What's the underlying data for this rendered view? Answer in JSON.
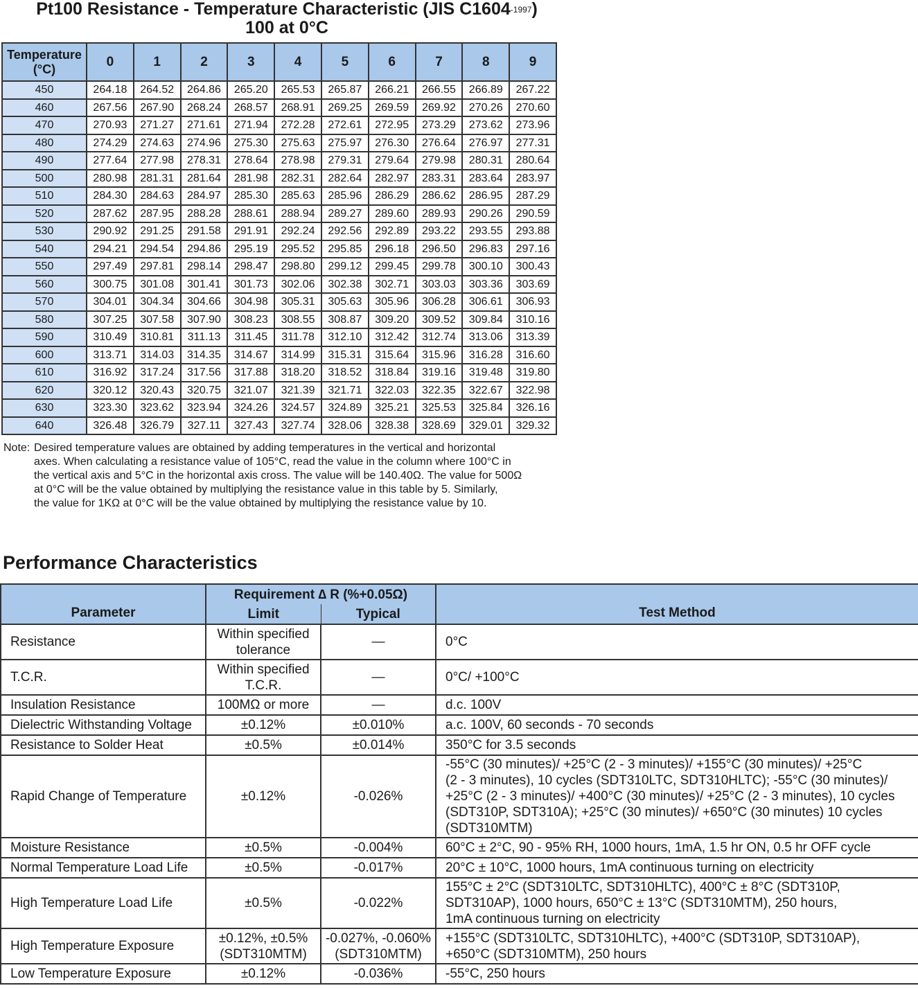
{
  "title": {
    "line1_main": "Pt100 Resistance - Temperature Characteristic (JIS C1604",
    "line1_sup": "-1997",
    "line1_close": ")",
    "line2": "100 at 0°C"
  },
  "resistance_table": {
    "header_temp_line1": "Temperature",
    "header_temp_line2": "(°C)",
    "columns": [
      "0",
      "1",
      "2",
      "3",
      "4",
      "5",
      "6",
      "7",
      "8",
      "9"
    ],
    "rows": [
      {
        "temp": "450",
        "values": [
          "264.18",
          "264.52",
          "264.86",
          "265.20",
          "265.53",
          "265.87",
          "266.21",
          "266.55",
          "266.89",
          "267.22"
        ]
      },
      {
        "temp": "460",
        "values": [
          "267.56",
          "267.90",
          "268.24",
          "268.57",
          "268.91",
          "269.25",
          "269.59",
          "269.92",
          "270.26",
          "270.60"
        ]
      },
      {
        "temp": "470",
        "values": [
          "270.93",
          "271.27",
          "271.61",
          "271.94",
          "272.28",
          "272.61",
          "272.95",
          "273.29",
          "273.62",
          "273.96"
        ]
      },
      {
        "temp": "480",
        "values": [
          "274.29",
          "274.63",
          "274.96",
          "275.30",
          "275.63",
          "275.97",
          "276.30",
          "276.64",
          "276.97",
          "277.31"
        ]
      },
      {
        "temp": "490",
        "values": [
          "277.64",
          "277.98",
          "278.31",
          "278.64",
          "278.98",
          "279.31",
          "279.64",
          "279.98",
          "280.31",
          "280.64"
        ]
      },
      {
        "temp": "500",
        "values": [
          "280.98",
          "281.31",
          "281.64",
          "281.98",
          "282.31",
          "282.64",
          "282.97",
          "283.31",
          "283.64",
          "283.97"
        ]
      },
      {
        "temp": "510",
        "values": [
          "284.30",
          "284.63",
          "284.97",
          "285.30",
          "285.63",
          "285.96",
          "286.29",
          "286.62",
          "286.95",
          "287.29"
        ]
      },
      {
        "temp": "520",
        "values": [
          "287.62",
          "287.95",
          "288.28",
          "288.61",
          "288.94",
          "289.27",
          "289.60",
          "289.93",
          "290.26",
          "290.59"
        ]
      },
      {
        "temp": "530",
        "values": [
          "290.92",
          "291.25",
          "291.58",
          "291.91",
          "292.24",
          "292.56",
          "292.89",
          "293.22",
          "293.55",
          "293.88"
        ]
      },
      {
        "temp": "540",
        "values": [
          "294.21",
          "294.54",
          "294.86",
          "295.19",
          "295.52",
          "295.85",
          "296.18",
          "296.50",
          "296.83",
          "297.16"
        ]
      },
      {
        "temp": "550",
        "values": [
          "297.49",
          "297.81",
          "298.14",
          "298.47",
          "298.80",
          "299.12",
          "299.45",
          "299.78",
          "300.10",
          "300.43"
        ]
      },
      {
        "temp": "560",
        "values": [
          "300.75",
          "301.08",
          "301.41",
          "301.73",
          "302.06",
          "302.38",
          "302.71",
          "303.03",
          "303.36",
          "303.69"
        ]
      },
      {
        "temp": "570",
        "values": [
          "304.01",
          "304.34",
          "304.66",
          "304.98",
          "305.31",
          "305.63",
          "305.96",
          "306.28",
          "306.61",
          "306.93"
        ]
      },
      {
        "temp": "580",
        "values": [
          "307.25",
          "307.58",
          "307.90",
          "308.23",
          "308.55",
          "308.87",
          "309.20",
          "309.52",
          "309.84",
          "310.16"
        ]
      },
      {
        "temp": "590",
        "values": [
          "310.49",
          "310.81",
          "311.13",
          "311.45",
          "311.78",
          "312.10",
          "312.42",
          "312.74",
          "313.06",
          "313.39"
        ]
      },
      {
        "temp": "600",
        "values": [
          "313.71",
          "314.03",
          "314.35",
          "314.67",
          "314.99",
          "315.31",
          "315.64",
          "315.96",
          "316.28",
          "316.60"
        ]
      },
      {
        "temp": "610",
        "values": [
          "316.92",
          "317.24",
          "317.56",
          "317.88",
          "318.20",
          "318.52",
          "318.84",
          "319.16",
          "319.48",
          "319.80"
        ]
      },
      {
        "temp": "620",
        "values": [
          "320.12",
          "320.43",
          "320.75",
          "321.07",
          "321.39",
          "321.71",
          "322.03",
          "322.35",
          "322.67",
          "322.98"
        ]
      },
      {
        "temp": "630",
        "values": [
          "323.30",
          "323.62",
          "323.94",
          "324.26",
          "324.57",
          "324.89",
          "325.21",
          "325.53",
          "325.84",
          "326.16"
        ]
      },
      {
        "temp": "640",
        "values": [
          "326.48",
          "326.79",
          "327.11",
          "327.43",
          "327.74",
          "328.06",
          "328.38",
          "328.69",
          "329.01",
          "329.32"
        ]
      }
    ]
  },
  "note": {
    "label": "Note:",
    "lines": [
      "Desired temperature values are obtained by adding temperatures in the vertical and horizontal",
      "axes. When calculating a resistance value of 105°C, read the value in the column where 100°C in",
      "the vertical axis and 5°C in the horizontal axis cross. The value will be 140.40Ω. The value for 500Ω",
      "at 0°C will be the value obtained by multiplying the resistance value in this table by 5. Similarly,",
      "the value for 1KΩ at 0°C will be the value obtained by multiplying the resistance value by 10."
    ]
  },
  "performance": {
    "title": "Performance Characteristics",
    "header": {
      "parameter": "Parameter",
      "requirement": "Requirement ∆ R (%+0.05Ω)",
      "limit": "Limit",
      "typical": "Typical",
      "test_method": "Test Method"
    },
    "rows": [
      {
        "parameter": "Resistance",
        "limit": [
          "Within specified",
          "tolerance"
        ],
        "typical": [
          "—"
        ],
        "method": [
          "0°C"
        ]
      },
      {
        "parameter": "T.C.R.",
        "limit": [
          "Within specified",
          "T.C.R."
        ],
        "typical": [
          "—"
        ],
        "method": [
          "0°C/ +100°C"
        ]
      },
      {
        "parameter": "Insulation Resistance",
        "limit": [
          "100MΩ or more"
        ],
        "typical": [
          "—"
        ],
        "method": [
          "d.c. 100V"
        ]
      },
      {
        "parameter": "Dielectric Withstanding Voltage",
        "limit": [
          "±0.12%"
        ],
        "typical": [
          "±0.010%"
        ],
        "method": [
          "a.c. 100V, 60 seconds - 70 seconds"
        ]
      },
      {
        "parameter": "Resistance to Solder Heat",
        "limit": [
          "±0.5%"
        ],
        "typical": [
          "±0.014%"
        ],
        "method": [
          "350°C for 3.5 seconds"
        ]
      },
      {
        "parameter": "Rapid Change of Temperature",
        "limit": [
          "±0.12%"
        ],
        "typical": [
          "-0.026%"
        ],
        "method": [
          "-55°C (30 minutes)/ +25°C (2 - 3 minutes)/ +155°C (30 minutes)/ +25°C",
          "(2 - 3 minutes), 10 cycles (SDT310LTC, SDT310HLTC); -55°C (30 minutes)/",
          "+25°C (2 - 3 minutes)/ +400°C (30 minutes)/ +25°C (2 - 3 minutes), 10 cycles",
          "(SDT310P, SDT310A); +25°C (30 minutes)/ +650°C (30 minutes) 10 cycles",
          "(SDT310MTM)"
        ]
      },
      {
        "parameter": "Moisture Resistance",
        "limit": [
          "±0.5%"
        ],
        "typical": [
          "-0.004%"
        ],
        "method": [
          "60°C ± 2°C, 90 - 95% RH, 1000 hours, 1mA, 1.5 hr ON, 0.5 hr OFF cycle"
        ]
      },
      {
        "parameter": "Normal Temperature Load Life",
        "limit": [
          "±0.5%"
        ],
        "typical": [
          "-0.017%"
        ],
        "method": [
          "20°C ± 10°C, 1000 hours, 1mA continuous turning on electricity"
        ]
      },
      {
        "parameter": "High Temperature Load Life",
        "limit": [
          "±0.5%"
        ],
        "typical": [
          "-0.022%"
        ],
        "method": [
          "155°C ± 2°C (SDT310LTC, SDT310HLTC), 400°C ± 8°C (SDT310P,",
          "SDT310AP), 1000 hours, 650°C ± 13°C (SDT310MTM), 250 hours,",
          "1mA continuous turning on electricity"
        ]
      },
      {
        "parameter": "High Temperature Exposure",
        "limit": [
          "±0.12%, ±0.5%",
          "(SDT310MTM)"
        ],
        "typical": [
          "-0.027%, -0.060%",
          "(SDT310MTM)"
        ],
        "method": [
          "+155°C (SDT310LTC, SDT310HLTC), +400°C (SDT310P, SDT310AP),",
          "+650°C (SDT310MTM), 250 hours"
        ]
      },
      {
        "parameter": "Low Temperature Exposure",
        "limit": [
          "±0.12%"
        ],
        "typical": [
          "-0.036%"
        ],
        "method": [
          "-55°C, 250 hours"
        ]
      }
    ]
  }
}
